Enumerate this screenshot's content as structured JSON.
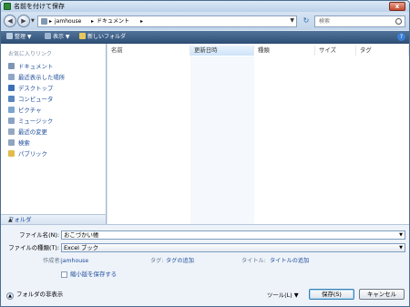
{
  "window": {
    "title": "名前を付けて保存",
    "close_label": "x"
  },
  "address_bar": {
    "crumbs": [
      "jamhouse",
      "ドキュメント"
    ],
    "search_placeholder": "検索"
  },
  "toolbar": {
    "organize": "整理",
    "views": "表示",
    "new_folder": "新しいフォルダ",
    "help": "?"
  },
  "nav": {
    "header": "お気に入りリンク",
    "links": [
      "ドキュメント",
      "最近表示した場所",
      "デスクトップ",
      "コンピュータ",
      "ピクチャ",
      "ミュージック",
      "最近の変更",
      "検索",
      "パブリック"
    ],
    "folders_label": "フォルダ"
  },
  "columns": [
    "名前",
    "更新日時",
    "種類",
    "サイズ",
    "タグ"
  ],
  "form": {
    "filename_label": "ファイル名(N):",
    "filename_value": "おこづかい帳",
    "filetype_label": "ファイルの種類(T):",
    "filetype_value": "Excel ブック",
    "author_label": "作成者:",
    "author_value": "jamhouse",
    "tags_label": "タグ:",
    "tags_value": "タグの追加",
    "title_label": "タイトル:",
    "title_value": "タイトルの追加",
    "thumbnail_label": "縮小版を保存する"
  },
  "footer": {
    "hide_folders": "フォルダの非表示",
    "tools": "ツール(L)",
    "save": "保存(S)",
    "cancel": "キャンセル"
  },
  "colors": {
    "toolbar": "#3a5c84",
    "link": "#1e4d9a"
  }
}
